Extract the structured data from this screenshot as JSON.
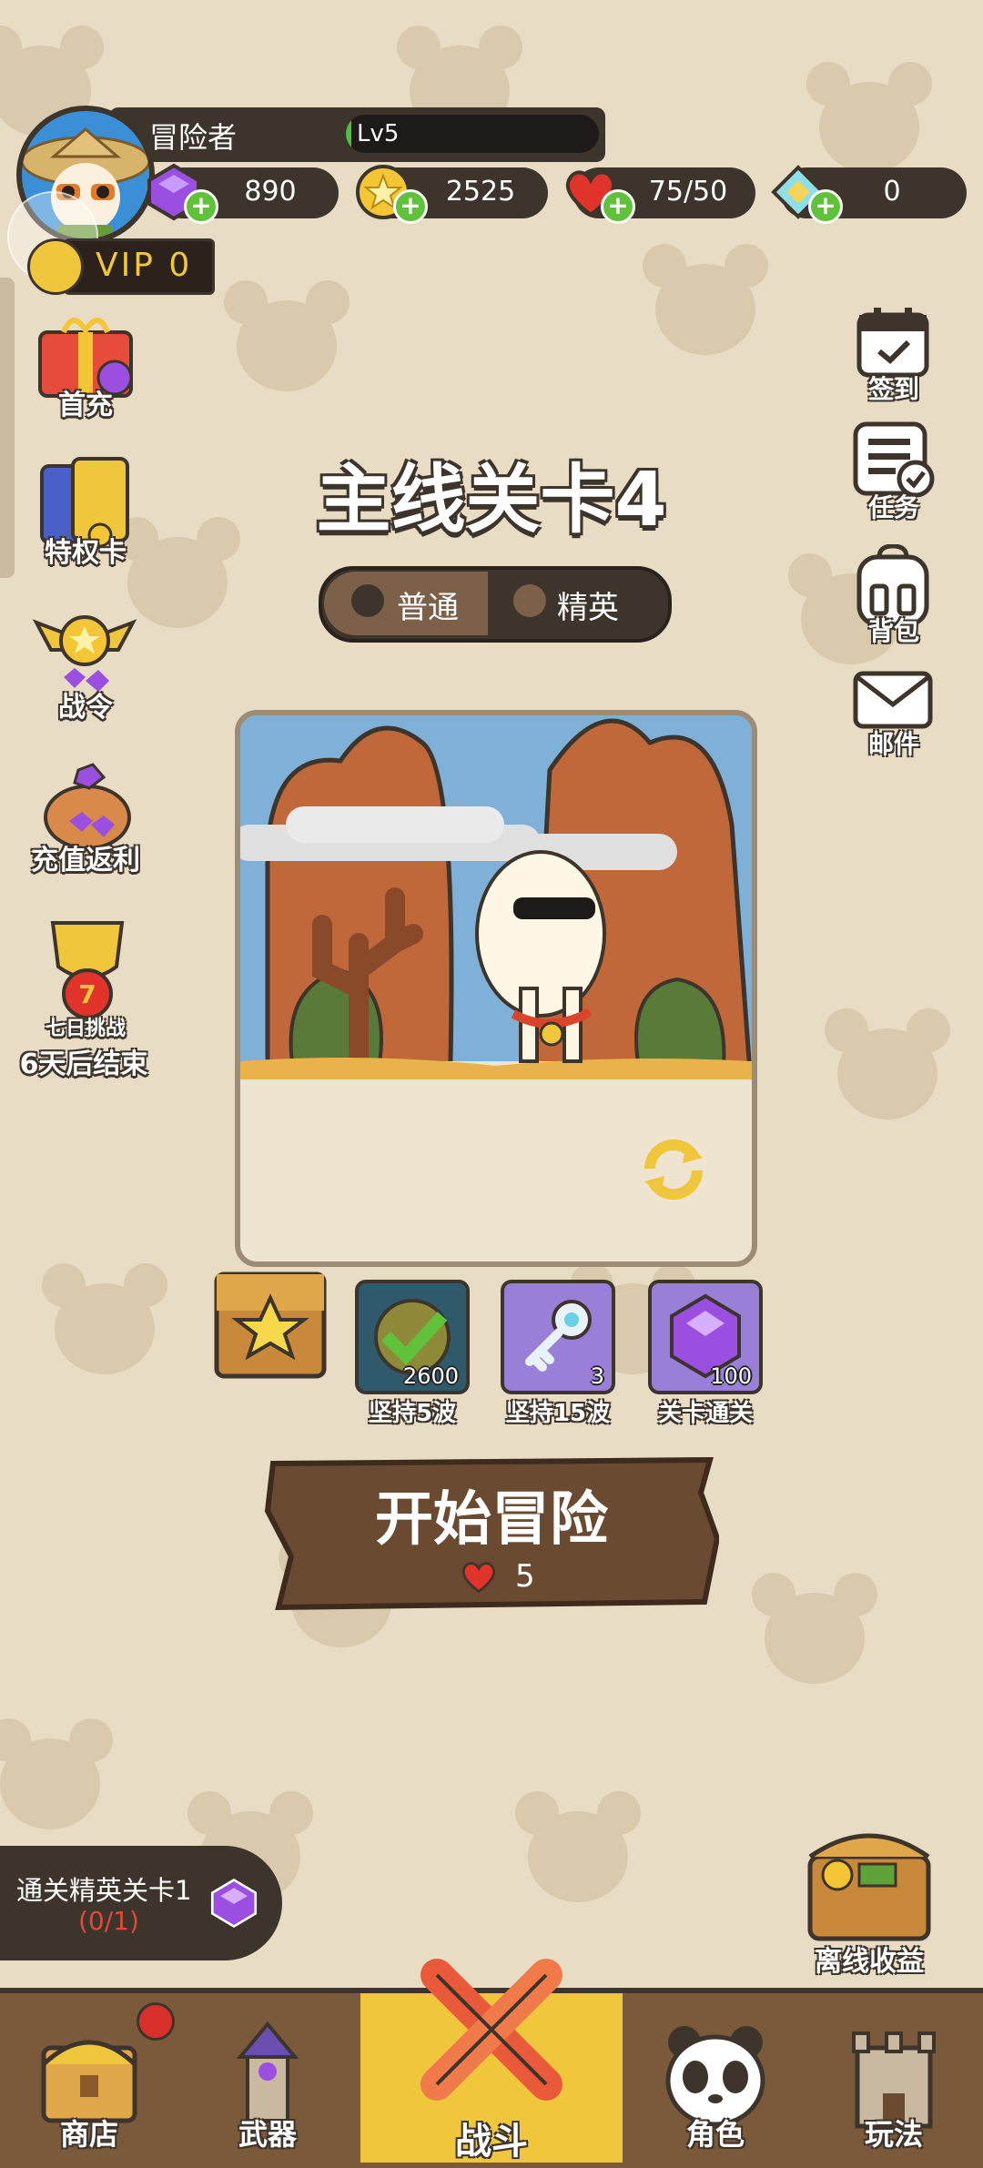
{
  "player": {
    "name": "冒险者",
    "level": "Lv5",
    "exp_fraction": 0.02,
    "vip": "VIP 0"
  },
  "currencies": [
    {
      "icon": "gem-icon",
      "value": "890"
    },
    {
      "icon": "coin-icon",
      "value": "2525"
    },
    {
      "icon": "heart-icon",
      "value": "75/50"
    },
    {
      "icon": "ticket-icon",
      "value": "0"
    }
  ],
  "left_menu": [
    {
      "icon": "gift-box-icon",
      "label": "首充"
    },
    {
      "icon": "privilege-card-icon",
      "label": "特权卡"
    },
    {
      "icon": "battle-pass-icon",
      "label": "战令"
    },
    {
      "icon": "piggy-bank-icon",
      "label": "充值返利"
    },
    {
      "icon": "trophy-icon",
      "label": "七日挑战",
      "sublabel": "6天后结束"
    }
  ],
  "right_menu": [
    {
      "icon": "calendar-checkin-icon",
      "label": "签到"
    },
    {
      "icon": "task-list-icon",
      "label": "任务"
    },
    {
      "icon": "backpack-icon",
      "label": "背包"
    },
    {
      "icon": "mail-icon",
      "label": "邮件"
    }
  ],
  "stage": {
    "title": "主线关卡4",
    "tabs": [
      {
        "label": "普通",
        "active": true
      },
      {
        "label": "精英",
        "active": false
      }
    ]
  },
  "rewards": [
    {
      "icon": "checkmark-coin-icon",
      "count": "2600",
      "caption": "坚持5波"
    },
    {
      "icon": "key-icon",
      "count": "3",
      "caption": "坚持15波"
    },
    {
      "icon": "gem-icon",
      "count": "100",
      "caption": "关卡通关"
    }
  ],
  "start": {
    "label": "开始冒险",
    "cost": "5"
  },
  "quest": {
    "text": "通关精英关卡1",
    "progress": "(0/1)"
  },
  "offline": {
    "label": "离线收益"
  },
  "nav": [
    {
      "icon": "shop-chest-icon",
      "label": "商店",
      "badge": true
    },
    {
      "icon": "weapon-tower-icon",
      "label": "武器"
    },
    {
      "icon": "crossed-swords-icon",
      "label": "战斗",
      "active": true
    },
    {
      "icon": "panda-icon",
      "label": "角色"
    },
    {
      "icon": "castle-icon",
      "label": "玩法"
    }
  ],
  "colors": {
    "background": "#e9dcc4",
    "dark_panel": "#3d342c",
    "accent_gold": "#f0c63c",
    "nav_bg": "#7a5a3a"
  }
}
